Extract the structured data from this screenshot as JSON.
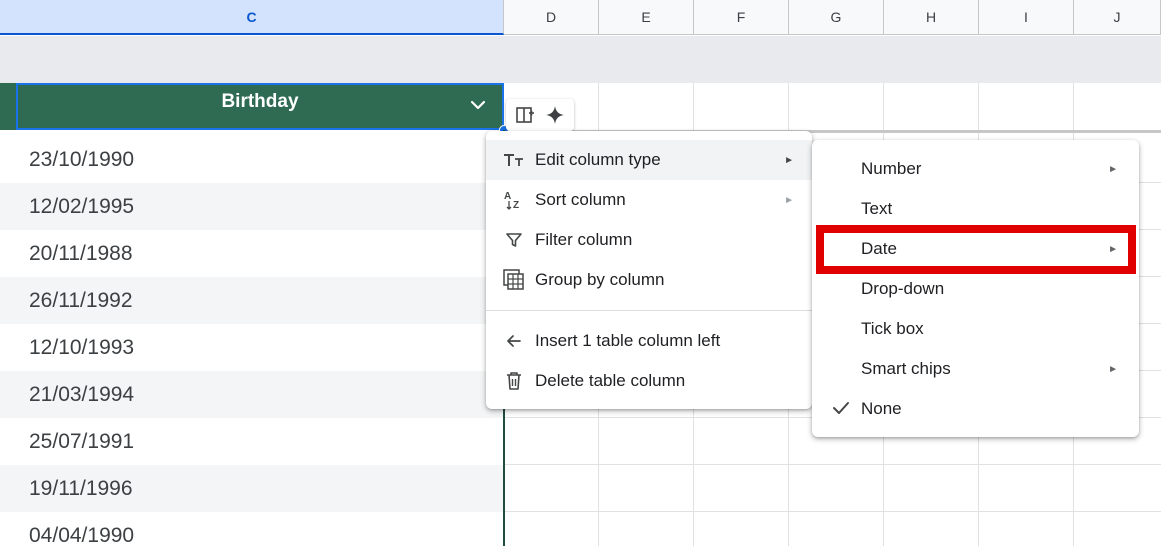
{
  "columns": {
    "headers": [
      "C",
      "D",
      "E",
      "F",
      "G",
      "H",
      "I",
      "J"
    ],
    "selected": "C"
  },
  "table": {
    "header_label": "Birthday",
    "header_color": "#2e6b52",
    "rows": [
      "23/10/1990",
      "12/02/1995",
      "20/11/1988",
      "26/11/1992",
      "12/10/1993",
      "21/03/1994",
      "25/07/1991",
      "19/11/1996",
      "04/04/1990"
    ]
  },
  "column_tools": {
    "icons": [
      "column-layout-icon",
      "sparkle-icon"
    ]
  },
  "context_menu": {
    "items": [
      {
        "label": "Edit column type",
        "icon": "text-type-icon",
        "has_submenu": true,
        "active": true
      },
      {
        "label": "Sort column",
        "icon": "sort-az-icon",
        "has_submenu": true
      },
      {
        "label": "Filter column",
        "icon": "filter-icon",
        "has_submenu": false
      },
      {
        "label": "Group by column",
        "icon": "group-table-icon",
        "has_submenu": false
      },
      {
        "label": "Insert 1 table column left",
        "icon": "arrow-left-icon",
        "has_submenu": false
      },
      {
        "label": "Delete table column",
        "icon": "trash-icon",
        "has_submenu": false
      }
    ]
  },
  "submenu": {
    "items": [
      {
        "label": "Number",
        "has_submenu": true,
        "checked": false
      },
      {
        "label": "Text",
        "has_submenu": false,
        "checked": false
      },
      {
        "label": "Date",
        "has_submenu": true,
        "checked": false,
        "highlighted": true
      },
      {
        "label": "Drop-down",
        "has_submenu": false,
        "checked": false
      },
      {
        "label": "Tick box",
        "has_submenu": false,
        "checked": false
      },
      {
        "label": "Smart chips",
        "has_submenu": true,
        "checked": false
      },
      {
        "label": "None",
        "has_submenu": false,
        "checked": true
      }
    ],
    "highlight_color": "#e00000"
  },
  "glyphs": {
    "submenu_arrow": "►",
    "check": "✓"
  }
}
